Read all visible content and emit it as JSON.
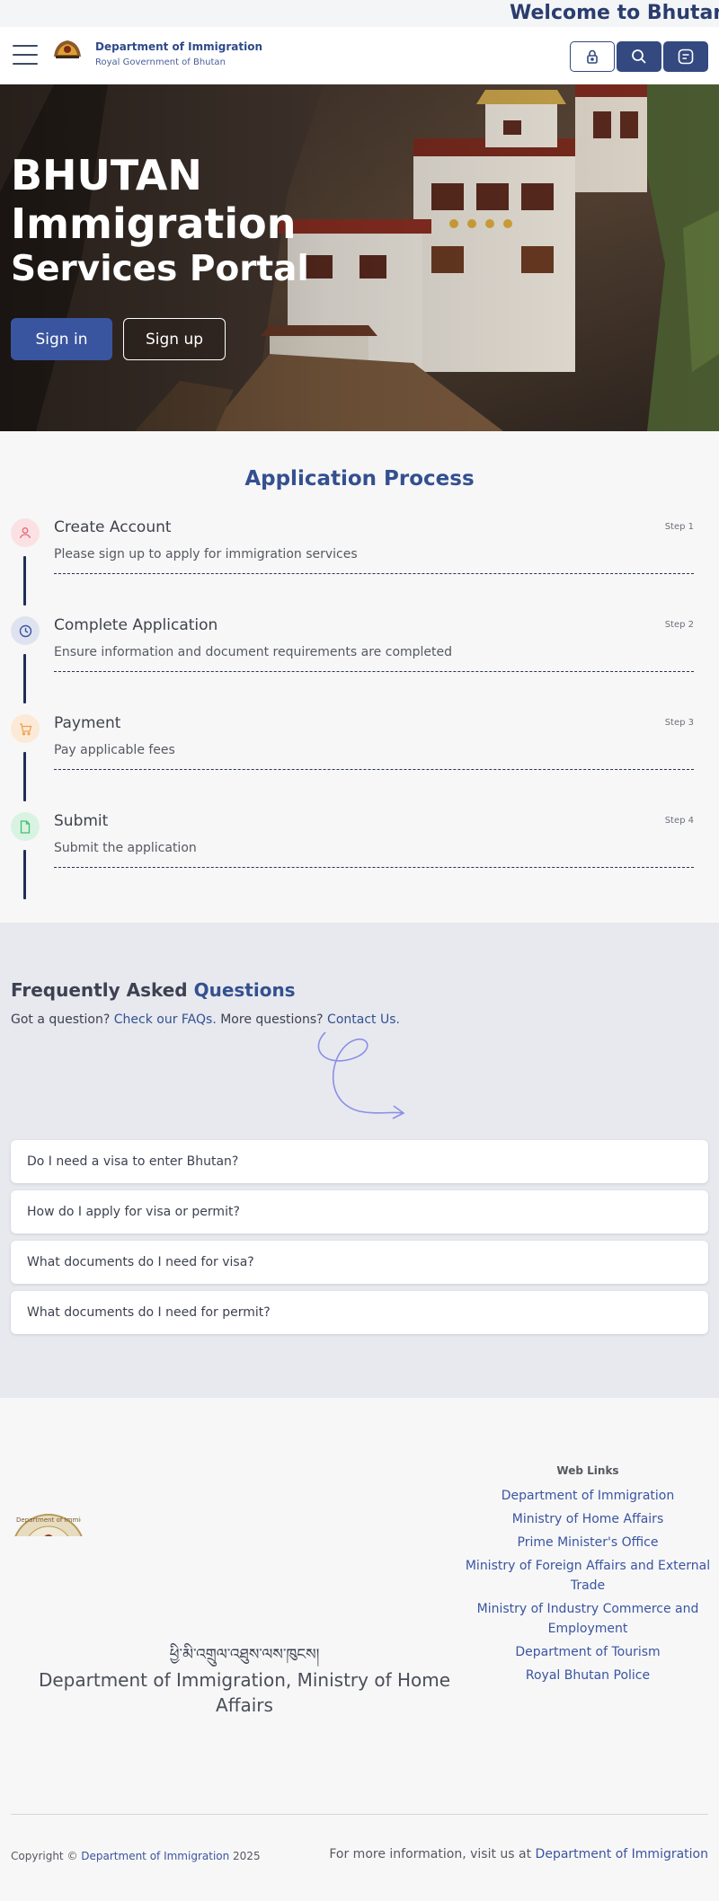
{
  "marquee": {
    "text": "Welcome to Bhutan In"
  },
  "header": {
    "department": "Department of Immigration",
    "government": "Royal Government of Bhutan"
  },
  "hero": {
    "title_line1": "BHUTAN",
    "title_line2": "Immigration",
    "title_line3": "Services Portal",
    "signin_label": "Sign in",
    "signup_label": "Sign up"
  },
  "process": {
    "title": "Application Process",
    "steps": [
      {
        "title": "Create Account",
        "step": "Step 1",
        "desc": "Please sign up to apply for immigration services",
        "icon": "user-icon",
        "color": "#e86a7a"
      },
      {
        "title": "Complete Application",
        "step": "Step 2",
        "desc": "Ensure information and document requirements are completed",
        "icon": "clock-icon",
        "color": "#3a55a0"
      },
      {
        "title": "Payment",
        "step": "Step 3",
        "desc": "Pay applicable fees",
        "icon": "cart-icon",
        "color": "#f0a050"
      },
      {
        "title": "Submit",
        "step": "Step 4",
        "desc": "Submit the application",
        "icon": "document-icon",
        "color": "#3fbf6f"
      }
    ]
  },
  "faq": {
    "title_plain": "Frequently Asked ",
    "title_accent": "Questions",
    "sub_prefix": "Got a question? ",
    "sub_link1": "Check our FAQs.",
    "sub_middle": " More questions? ",
    "sub_link2": "Contact Us.",
    "items": [
      "Do I need a visa to enter Bhutan?",
      "How do I apply for visa or permit?",
      "What documents do I need for visa?",
      "What documents do I need for permit?"
    ]
  },
  "footer": {
    "seal_text": "Department of Immigration",
    "dzongkha": "ཕྱི་མི་འགྲུལ་འཐུས་ལས་ཁུངས།",
    "department": "Department of Immigration, Ministry of Home Affairs",
    "weblinks_title": "Web Links",
    "weblinks": [
      "Department of Immigration",
      "Ministry of Home Affairs",
      "Prime Minister's Office",
      "Ministry of Foreign Affairs and External Trade",
      "Ministry of Industry Commerce and Employment",
      "Department of Tourism",
      "Royal Bhutan Police"
    ],
    "copyright_prefix": "Copyright © ",
    "copyright_link": "Department of Immigration",
    "copyright_year": " 2025",
    "more_prefix": "For more information, visit us at ",
    "more_link": "Department of Immigration"
  }
}
